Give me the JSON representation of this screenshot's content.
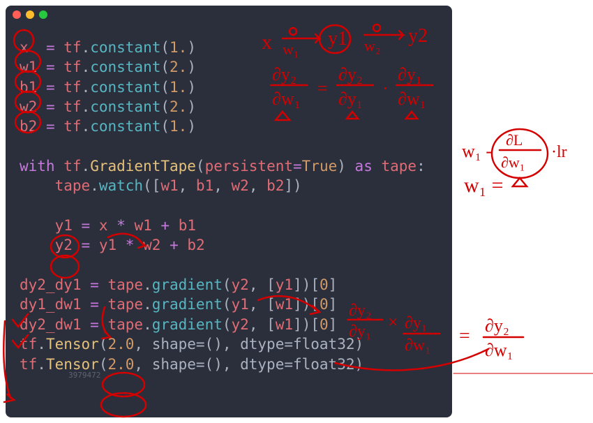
{
  "traffic": {
    "red": "#ff5f56",
    "yellow": "#ffbd2e",
    "green": "#27c93f"
  },
  "code": {
    "assign": {
      "x": {
        "lhs": "x",
        "call": "tf.constant",
        "arg": "1."
      },
      "w1": {
        "lhs": "w1",
        "call": "tf.constant",
        "arg": "2."
      },
      "b1": {
        "lhs": "b1",
        "call": "tf.constant",
        "arg": "1."
      },
      "w2": {
        "lhs": "w2",
        "call": "tf.constant",
        "arg": "2."
      },
      "b2": {
        "lhs": "b2",
        "call": "tf.constant",
        "arg": "1."
      }
    },
    "with": {
      "kw_with": "with",
      "mod": "tf",
      "cls": "GradientTape",
      "arg_name": "persistent",
      "eq": "=",
      "arg_val": "True",
      "kw_as": "as",
      "name": "tape",
      "colon": ":",
      "watch": {
        "obj": "tape",
        "fn": "watch",
        "args": [
          "w1",
          "b1",
          "w2",
          "b2"
        ]
      }
    },
    "y": {
      "y1": {
        "lhs": "y1",
        "expr": "x * w1 + b1",
        "a": "x",
        "b": "w1",
        "c": "b1"
      },
      "y2": {
        "lhs": "y2",
        "expr": "y1 * w2 + b2",
        "a": "y1",
        "b": "w2",
        "c": "b2"
      }
    },
    "grads": {
      "g1": {
        "lhs": "dy2_dy1",
        "obj": "tape",
        "fn": "gradient",
        "a": "y2",
        "b": "y1",
        "idx": "0"
      },
      "g2": {
        "lhs": "dy1_dw1",
        "obj": "tape",
        "fn": "gradient",
        "a": "y1",
        "b": "w1",
        "idx": "0"
      },
      "g3": {
        "lhs": "dy2_dw1",
        "obj": "tape",
        "fn": "gradient",
        "a": "y2",
        "b": "w1",
        "idx": "0"
      }
    },
    "out": {
      "o1": {
        "prefix": "tf.Tensor(",
        "val": "2.0",
        "suffix": ", shape=(), dtype=float32)"
      },
      "o2": {
        "prefix": "tf.Tensor(",
        "val": "2.0",
        "suffix": ", shape=(), dtype=float32)"
      }
    },
    "watermark": "3979472"
  },
  "annotations": {
    "color": "#d40000",
    "text": {
      "x": "x",
      "y1": "y1",
      "y2": "y2",
      "lr": "lr",
      "w1u": "w₁",
      "w2u": "w₂",
      "chain_left": "∂y₂/∂w₁",
      "chain_mid": "∂y₂/∂y₁",
      "chain_right": "∂y₁/∂w₁",
      "eq": "=",
      "dot": "·",
      "times": "×",
      "update_lhs": "w₁ -",
      "update_rhs": "∂L/∂w₁",
      "update_eq": "w₁ ="
    }
  }
}
